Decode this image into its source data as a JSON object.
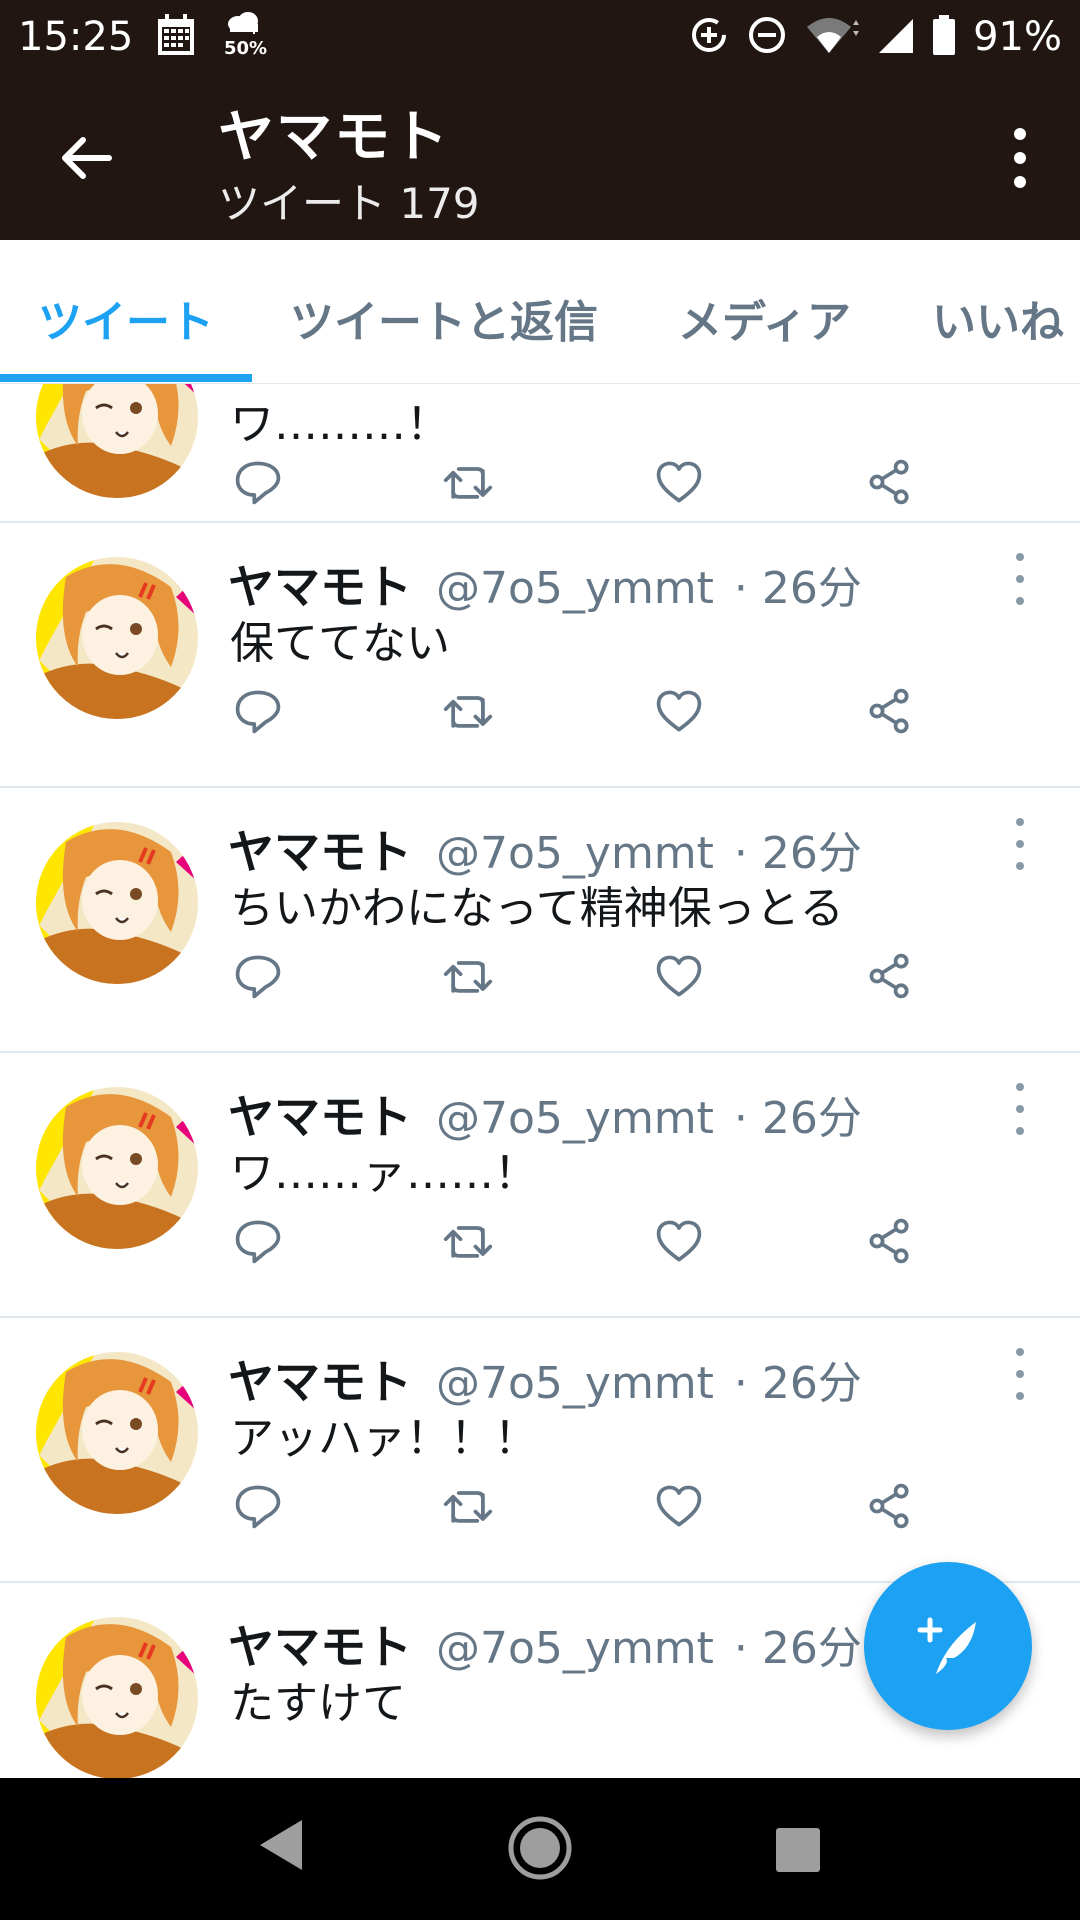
{
  "status_bar": {
    "time": "15:25",
    "weather_text": "50%",
    "battery_text": "91%",
    "icons": [
      "calendar-icon",
      "weather-icon",
      "data-saver-icon",
      "do-not-disturb-icon",
      "wifi-icon",
      "signal-icon",
      "battery-icon"
    ]
  },
  "app_bar": {
    "title": "ヤマモト",
    "subtitle": "ツイート 179",
    "back_icon": "back-arrow-icon",
    "overflow_icon": "more-vertical-icon"
  },
  "tabs": [
    {
      "label": "ツイート",
      "active": true
    },
    {
      "label": "ツイートと返信",
      "active": false
    },
    {
      "label": "メディア",
      "active": false
    },
    {
      "label": "いいね",
      "active": false
    }
  ],
  "tweets": [
    {
      "name": "",
      "handle": "",
      "time": "",
      "text": "ワ………！"
    },
    {
      "name": "ヤマモト",
      "handle": "@7o5_ymmt",
      "time": "· 26分",
      "text": "保ててない"
    },
    {
      "name": "ヤマモト",
      "handle": "@7o5_ymmt",
      "time": "· 26分",
      "text": "ちいかわになって精神保っとる"
    },
    {
      "name": "ヤマモト",
      "handle": "@7o5_ymmt",
      "time": "· 26分",
      "text": "ワ……ァ……！"
    },
    {
      "name": "ヤマモト",
      "handle": "@7o5_ymmt",
      "time": "· 26分",
      "text": "アッハァ！！！"
    },
    {
      "name": "ヤマモト",
      "handle": "@7o5_ymmt",
      "time": "· 26分",
      "text": "たすけて"
    }
  ],
  "tweet_actions": [
    "reply-icon",
    "retweet-icon",
    "like-icon",
    "share-icon"
  ],
  "fab": {
    "icon": "compose-tweet-icon"
  },
  "nav_bar": {
    "icons": [
      "nav-back-icon",
      "nav-home-icon",
      "nav-recents-icon"
    ]
  },
  "colors": {
    "header_bg": "#211611",
    "accent": "#1da1f2",
    "text_primary": "#14171a",
    "text_secondary": "#657786",
    "divider": "#e1e8ed"
  }
}
